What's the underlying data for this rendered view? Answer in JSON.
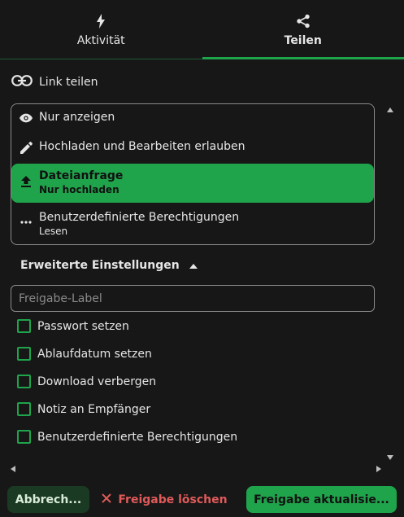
{
  "tabs": [
    {
      "label": "Aktivität",
      "icon": "lightning-icon",
      "active": false
    },
    {
      "label": "Teilen",
      "icon": "share-icon",
      "active": true
    }
  ],
  "link_share": {
    "label": "Link teilen",
    "icon": "link-icon"
  },
  "permissions": [
    {
      "title": "Nur anzeigen",
      "subtitle": "",
      "icon": "eye-icon"
    },
    {
      "title": "Hochladen und Bearbeiten erlauben",
      "subtitle": "",
      "icon": "pencil-icon"
    },
    {
      "title": "Dateianfrage",
      "subtitle": "Nur hochladen",
      "icon": "upload-icon",
      "selected": true
    },
    {
      "title": "Benutzerdefinierte Berechtigungen",
      "subtitle": "Lesen",
      "icon": "more-icon"
    }
  ],
  "advanced": {
    "label": "Erweiterte Einstellungen",
    "icon": "caret-up-icon"
  },
  "share_label_input": {
    "value": "",
    "placeholder": "Freigabe-Label"
  },
  "checkboxes": [
    {
      "label": "Passwort setzen",
      "checked": false
    },
    {
      "label": "Ablaufdatum setzen",
      "checked": false
    },
    {
      "label": "Download verbergen",
      "checked": false
    },
    {
      "label": "Notiz an Empfänger",
      "checked": false
    },
    {
      "label": "Benutzerdefinierte Berechtigungen",
      "checked": false
    }
  ],
  "footer": {
    "cancel_label": "Abbrech...",
    "delete_label": "Freigabe löschen",
    "update_label": "Freigabe aktualisie..."
  },
  "colors": {
    "accent": "#1fa34b",
    "background": "#171717",
    "danger": "#e05a5a"
  }
}
